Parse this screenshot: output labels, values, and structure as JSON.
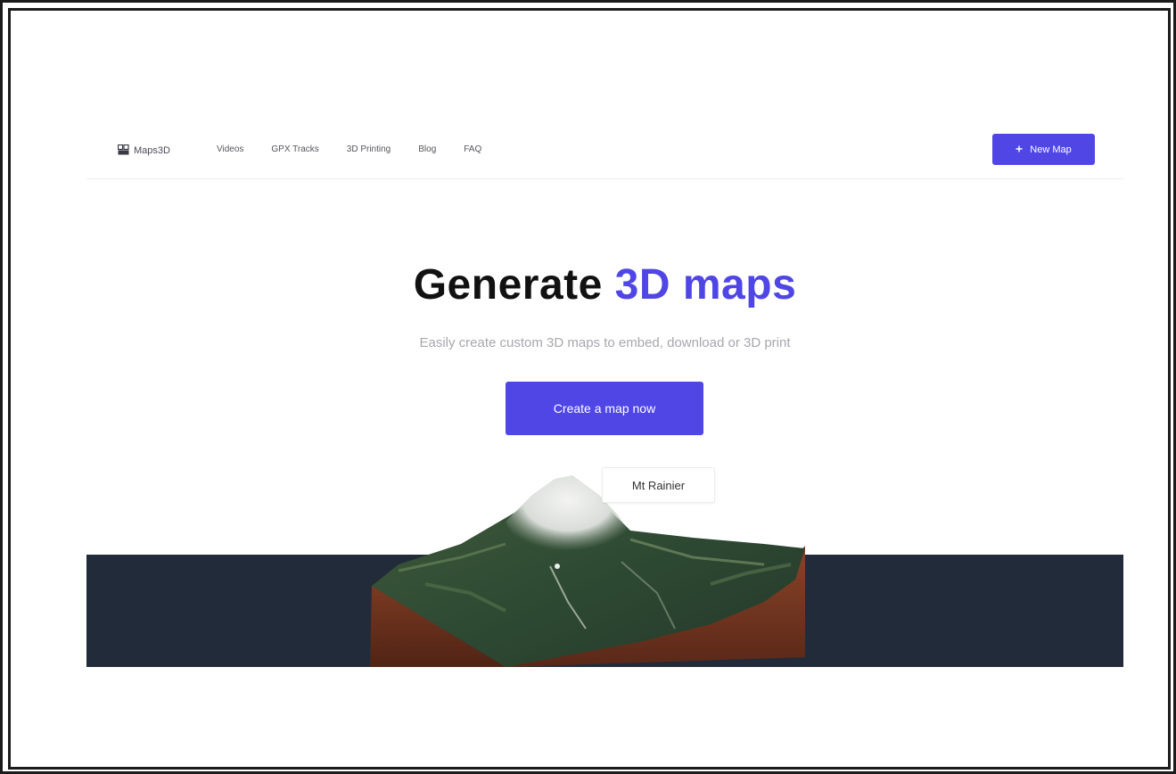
{
  "nav": {
    "logo_icon": "map-grid-icon",
    "logo_text": "Maps3D",
    "links": [
      "Videos",
      "GPX Tracks",
      "3D Printing",
      "Blog",
      "FAQ"
    ],
    "new_map_icon": "plus-icon",
    "new_map_label": "New Map"
  },
  "hero": {
    "title_main": "Generate",
    "title_accent": "3D maps",
    "subtitle": "Easily create custom 3D maps to embed, download or 3D print",
    "cta_label": "Create a map now"
  },
  "preview": {
    "location_label": "Mt Rainier"
  },
  "colors": {
    "accent": "#4f46e5",
    "dark_band": "#222b39",
    "terrain_side": "#6b3320"
  }
}
